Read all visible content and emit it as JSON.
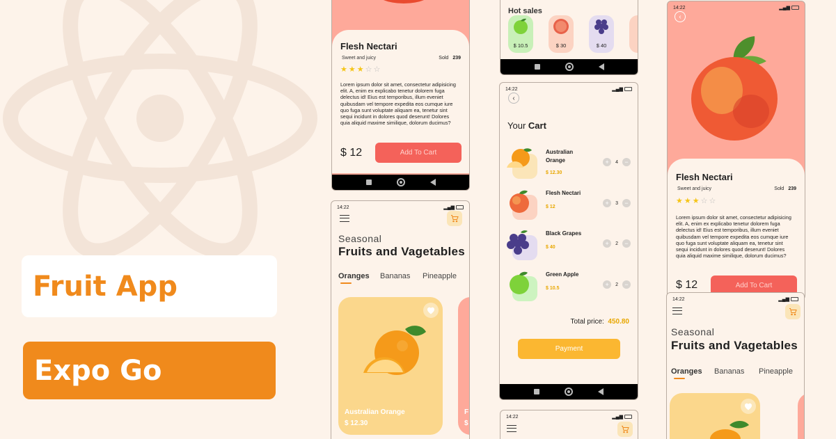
{
  "promo": {
    "line1": "Fruit App",
    "line2": "Expo Go"
  },
  "status": {
    "time": "14:22"
  },
  "detail": {
    "title": "Flesh Nectari",
    "subtitle": "Sweet and juicy",
    "sold_label": "Sold",
    "sold_count": "239",
    "rating": 3,
    "rating_max": 5,
    "description": "Lorem ipsum dolor sit amet, consectetur adipisicing elit. A, enim ex explicabo tenetur dolorem fuga delectus id! Eius est temporibus, illum eveniet quibusdam vel tempore expedita eos cumque iure quo fuga sunt voluptate aliquam ea, tenetur sint sequi incidunt in dolores quod deserunt! Dolores quia aliquid maxime similique, dolorum ducimus?",
    "price": "$ 12",
    "add_button": "Add To Cart"
  },
  "hot_sales": {
    "title": "Hot sales",
    "items": [
      {
        "name": "apple",
        "price": "$ 10.5",
        "bg": "#c8f0b8"
      },
      {
        "name": "grapefruit",
        "price": "$ 30",
        "bg": "#fcd3c2"
      },
      {
        "name": "grapes",
        "price": "$ 40",
        "bg": "#e4dcf0"
      },
      {
        "name": "peach",
        "price": "",
        "bg": "#fcd3c2"
      }
    ]
  },
  "cart": {
    "title_prefix": "Your",
    "title_bold": "Cart",
    "items": [
      {
        "name": "Australian Orange",
        "price": "$ 12.30",
        "qty": "4",
        "bg": "#fbe5b8"
      },
      {
        "name": "Flesh Nectari",
        "price": "$ 12",
        "qty": "3",
        "bg": "#fcd3c2"
      },
      {
        "name": "Black Grapes",
        "price": "$ 40",
        "qty": "2",
        "bg": "#e4dcf0"
      },
      {
        "name": "Green Apple",
        "price": "$ 10.5",
        "qty": "2",
        "bg": "#cdf3c0"
      }
    ],
    "total_label": "Total price:",
    "total_value": "450.80",
    "payment_button": "Payment"
  },
  "home": {
    "season": "Seasonal",
    "title": "Fruits and Vagetables",
    "tabs": [
      "Oranges",
      "Bananas",
      "Pineapple"
    ],
    "active_tab": "Oranges",
    "featured": {
      "name": "Australian Orange",
      "price": "$ 12.30"
    },
    "peek_name": "F",
    "peek_price": "$"
  },
  "colors": {
    "accent": "#f08a1c",
    "peach_bg": "#fea99a",
    "orange_card": "#fbd78c",
    "add_btn": "#f4625a",
    "payment_btn": "#fbb731"
  }
}
